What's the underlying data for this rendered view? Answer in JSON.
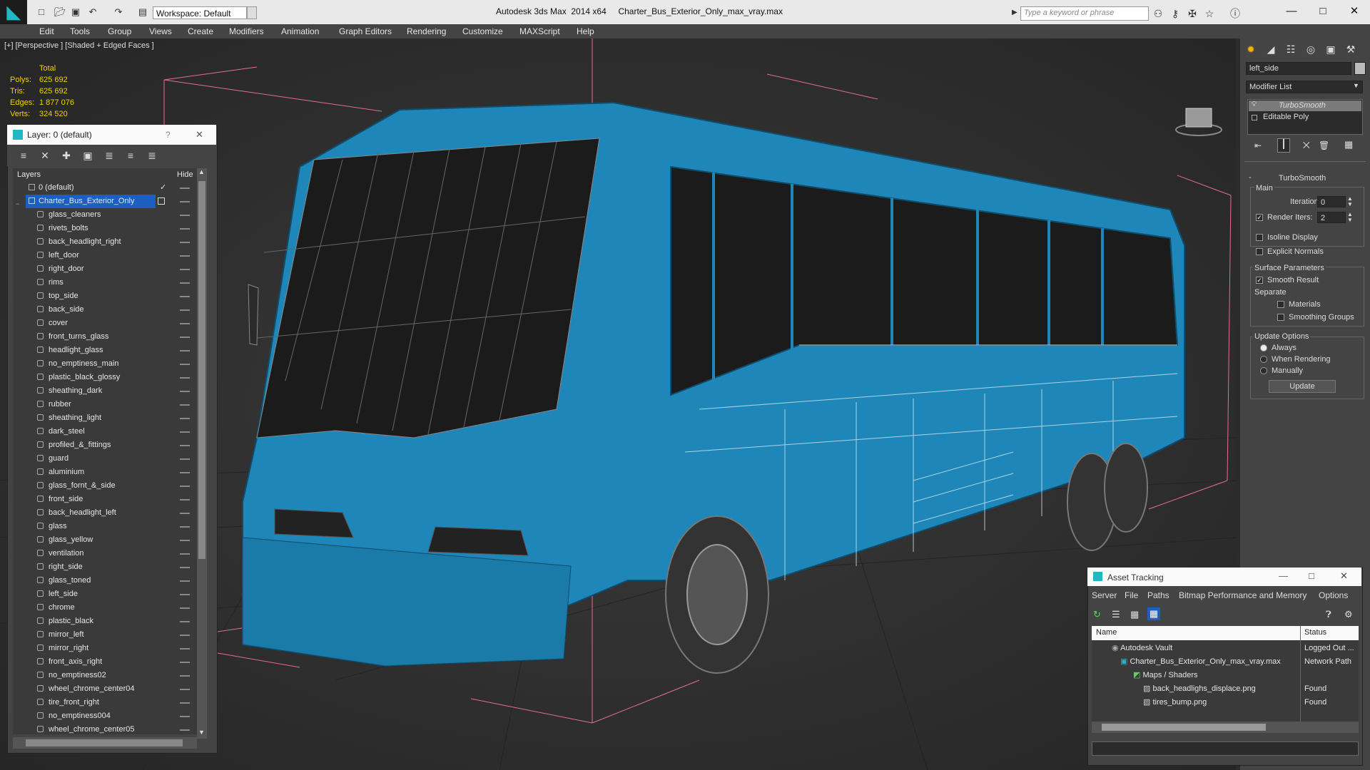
{
  "titlebar": {
    "workspace": "Workspace: Default",
    "app_name": "Autodesk 3ds Max  2014 x64",
    "file_name": "Charter_Bus_Exterior_Only_max_vray.max",
    "search_placeholder": "Type a keyword or phrase"
  },
  "menu": [
    "Edit",
    "Tools",
    "Group",
    "Views",
    "Create",
    "Modifiers",
    "Animation",
    "Graph Editors",
    "Rendering",
    "Customize",
    "MAXScript",
    "Help"
  ],
  "viewport": {
    "label": "[+] [Perspective ] [Shaded + Edged Faces ]",
    "stats": {
      "header": "Total",
      "rows": [
        {
          "label": "Polys:",
          "value": "625 692"
        },
        {
          "label": "Tris:",
          "value": "625 692"
        },
        {
          "label": "Edges:",
          "value": "1 877 076"
        },
        {
          "label": "Verts:",
          "value": "324 520"
        }
      ]
    },
    "model_color": "#1e86b8"
  },
  "layer_panel": {
    "title": "Layer: 0 (default)",
    "help": "?",
    "close": "✕",
    "col_layers": "Layers",
    "col_hide": "Hide",
    "default_layer": "0 (default)",
    "selected_layer": "Charter_Bus_Exterior_Only",
    "objects": [
      "glass_cleaners",
      "rivets_bolts",
      "back_headlight_right",
      "left_door",
      "right_door",
      "rims",
      "top_side",
      "back_side",
      "cover",
      "front_turns_glass",
      "headlight_glass",
      "no_emptiness_main",
      "plastic_black_glossy",
      "sheathing_dark",
      "rubber",
      "sheathing_light",
      "dark_steel",
      "profiled_&_fittings",
      "guard",
      "aluminium",
      "glass_fornt_&_side",
      "front_side",
      "back_headlight_left",
      "glass",
      "glass_yellow",
      "ventilation",
      "right_side",
      "glass_toned",
      "left_side",
      "chrome",
      "plastic_black",
      "mirror_left",
      "mirror_right",
      "front_axis_right",
      "no_emptiness02",
      "wheel_chrome_center04",
      "tire_front_right",
      "no_emptiness004",
      "wheel_chrome_center05"
    ]
  },
  "command_panel": {
    "object_name": "left_side",
    "modifier_list": "Modifier List",
    "stack": [
      "TurboSmooth",
      "Editable Poly"
    ],
    "rollout": "TurboSmooth",
    "main": "Main",
    "iterations_label": "Iterations:",
    "iterations": "0",
    "render_iters_label": "Render Iters:",
    "render_iters": "2",
    "isoline": "Isoline Display",
    "explicit_normals": "Explicit Normals",
    "surface_params": "Surface Parameters",
    "smooth_result": "Smooth Result",
    "separate": "Separate",
    "materials": "Materials",
    "smoothing_groups": "Smoothing Groups",
    "update_options": "Update Options",
    "always": "Always",
    "when_rendering": "When Rendering",
    "manually": "Manually",
    "update": "Update",
    "minus": "-"
  },
  "asset_tracking": {
    "title": "Asset Tracking",
    "menu": [
      "Server",
      "File",
      "Paths",
      "Bitmap Performance and Memory",
      "Options"
    ],
    "col_name": "Name",
    "col_status": "Status",
    "rows": [
      {
        "name": "Autodesk Vault",
        "status": "Logged Out ..."
      },
      {
        "name": "Charter_Bus_Exterior_Only_max_vray.max",
        "status": "Network Path"
      },
      {
        "name": "Maps / Shaders",
        "status": ""
      },
      {
        "name": "back_headlighs_displace.png",
        "status": "Found"
      },
      {
        "name": "tires_bump.png",
        "status": "Found"
      }
    ]
  }
}
